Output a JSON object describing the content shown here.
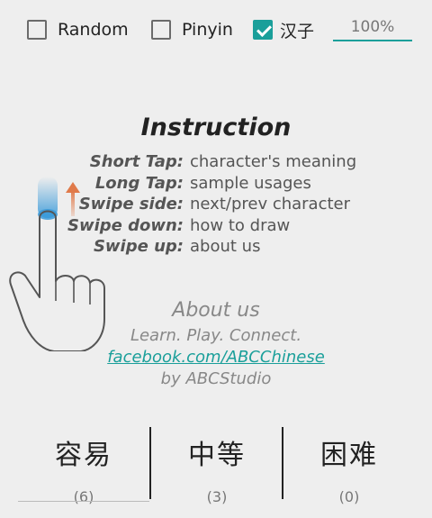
{
  "options": {
    "random_label": "Random",
    "random_checked": false,
    "pinyin_label": "Pinyin",
    "pinyin_checked": false,
    "hanzi_label": "汉子",
    "hanzi_checked": true,
    "zoom_value": "100%"
  },
  "instruction": {
    "title": "Instruction",
    "rows": [
      {
        "key": "Short Tap:",
        "value": "character's meaning"
      },
      {
        "key": "Long Tap:",
        "value": "sample usages"
      },
      {
        "key": "Swipe side:",
        "value": "next/prev character"
      },
      {
        "key": "Swipe down:",
        "value": "how to draw"
      },
      {
        "key": "Swipe up:",
        "value": "about us"
      }
    ]
  },
  "about": {
    "title": "About us",
    "tagline": "Learn. Play. Connect.",
    "link": "facebook.com/ABCChinese",
    "by": "by ABCStudio"
  },
  "levels": [
    {
      "name": "容易",
      "count": "(6)"
    },
    {
      "name": "中等",
      "count": "(3)"
    },
    {
      "name": "困难",
      "count": "(0)"
    }
  ],
  "colors": {
    "accent": "#1a9f9a",
    "arrow": "#e07a4a",
    "touch": "#3a9ad9"
  },
  "icons": {
    "gesture": "swipe-up-hand-icon"
  }
}
